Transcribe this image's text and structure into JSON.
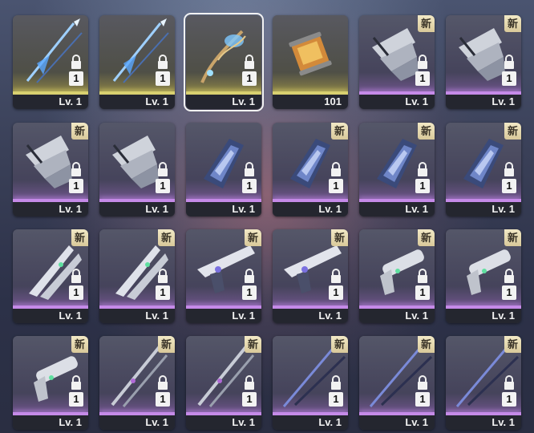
{
  "inventory": {
    "items": [
      {
        "level": "Lv. 1",
        "qty": "1",
        "new": false,
        "icon": "spear-icon",
        "rarity": "gold",
        "selected": false
      },
      {
        "level": "Lv. 1",
        "qty": "1",
        "new": false,
        "icon": "spear-icon",
        "rarity": "gold",
        "selected": false
      },
      {
        "level": "Lv. 1",
        "qty": "1",
        "new": false,
        "icon": "staff-icon",
        "rarity": "gold",
        "selected": true
      },
      {
        "level": "101",
        "qty": "",
        "new": false,
        "icon": "capsule-icon",
        "rarity": "gold",
        "selected": false
      },
      {
        "level": "Lv. 1",
        "qty": "1",
        "new": true,
        "new_label": "新",
        "icon": "wing-blade-icon",
        "rarity": "purple",
        "selected": false
      },
      {
        "level": "Lv. 1",
        "qty": "1",
        "new": true,
        "new_label": "新",
        "icon": "wing-blade-icon",
        "rarity": "purple",
        "selected": false
      },
      {
        "level": "Lv. 1",
        "qty": "1",
        "new": true,
        "new_label": "新",
        "icon": "wing-blade-icon",
        "rarity": "purple",
        "selected": false
      },
      {
        "level": "Lv. 1",
        "qty": "1",
        "new": false,
        "icon": "wing-blade-icon",
        "rarity": "purple",
        "selected": false
      },
      {
        "level": "Lv. 1",
        "qty": "1",
        "new": false,
        "icon": "shield-icon",
        "rarity": "purple",
        "selected": false
      },
      {
        "level": "Lv. 1",
        "qty": "1",
        "new": true,
        "new_label": "新",
        "icon": "shield-icon",
        "rarity": "purple",
        "selected": false
      },
      {
        "level": "Lv. 1",
        "qty": "1",
        "new": true,
        "new_label": "新",
        "icon": "shield-icon",
        "rarity": "purple",
        "selected": false
      },
      {
        "level": "Lv. 1",
        "qty": "1",
        "new": true,
        "new_label": "新",
        "icon": "shield-icon",
        "rarity": "purple",
        "selected": false
      },
      {
        "level": "Lv. 1",
        "qty": "1",
        "new": true,
        "new_label": "新",
        "icon": "dual-blade-icon",
        "rarity": "purple",
        "selected": false
      },
      {
        "level": "Lv. 1",
        "qty": "1",
        "new": true,
        "new_label": "新",
        "icon": "dual-blade-icon",
        "rarity": "purple",
        "selected": false
      },
      {
        "level": "Lv. 1",
        "qty": "1",
        "new": true,
        "new_label": "新",
        "icon": "pistol-icon",
        "rarity": "purple",
        "selected": false
      },
      {
        "level": "Lv. 1",
        "qty": "1",
        "new": true,
        "new_label": "新",
        "icon": "pistol-icon",
        "rarity": "purple",
        "selected": false
      },
      {
        "level": "Lv. 1",
        "qty": "1",
        "new": true,
        "new_label": "新",
        "icon": "revolver-icon",
        "rarity": "purple",
        "selected": false
      },
      {
        "level": "Lv. 1",
        "qty": "1",
        "new": true,
        "new_label": "新",
        "icon": "revolver-icon",
        "rarity": "purple",
        "selected": false
      },
      {
        "level": "Lv. 1",
        "qty": "1",
        "new": true,
        "new_label": "新",
        "icon": "revolver-icon",
        "rarity": "purple",
        "selected": false
      },
      {
        "level": "Lv. 1",
        "qty": "1",
        "new": true,
        "new_label": "新",
        "icon": "katana-icon",
        "rarity": "purple",
        "selected": false
      },
      {
        "level": "Lv. 1",
        "qty": "1",
        "new": true,
        "new_label": "新",
        "icon": "katana-icon",
        "rarity": "purple",
        "selected": false
      },
      {
        "level": "Lv. 1",
        "qty": "1",
        "new": true,
        "new_label": "新",
        "icon": "lance-icon",
        "rarity": "purple",
        "selected": false
      },
      {
        "level": "Lv. 1",
        "qty": "1",
        "new": true,
        "new_label": "新",
        "icon": "lance-icon",
        "rarity": "purple",
        "selected": false
      },
      {
        "level": "Lv. 1",
        "qty": "1",
        "new": true,
        "new_label": "新",
        "icon": "lance-icon",
        "rarity": "purple",
        "selected": false
      }
    ]
  },
  "colors": {
    "purple_bar": "#c58ae8",
    "gold_bar": "#d8d070",
    "level_bg": "#24262f",
    "badge_bg": "#e8dcb2"
  }
}
